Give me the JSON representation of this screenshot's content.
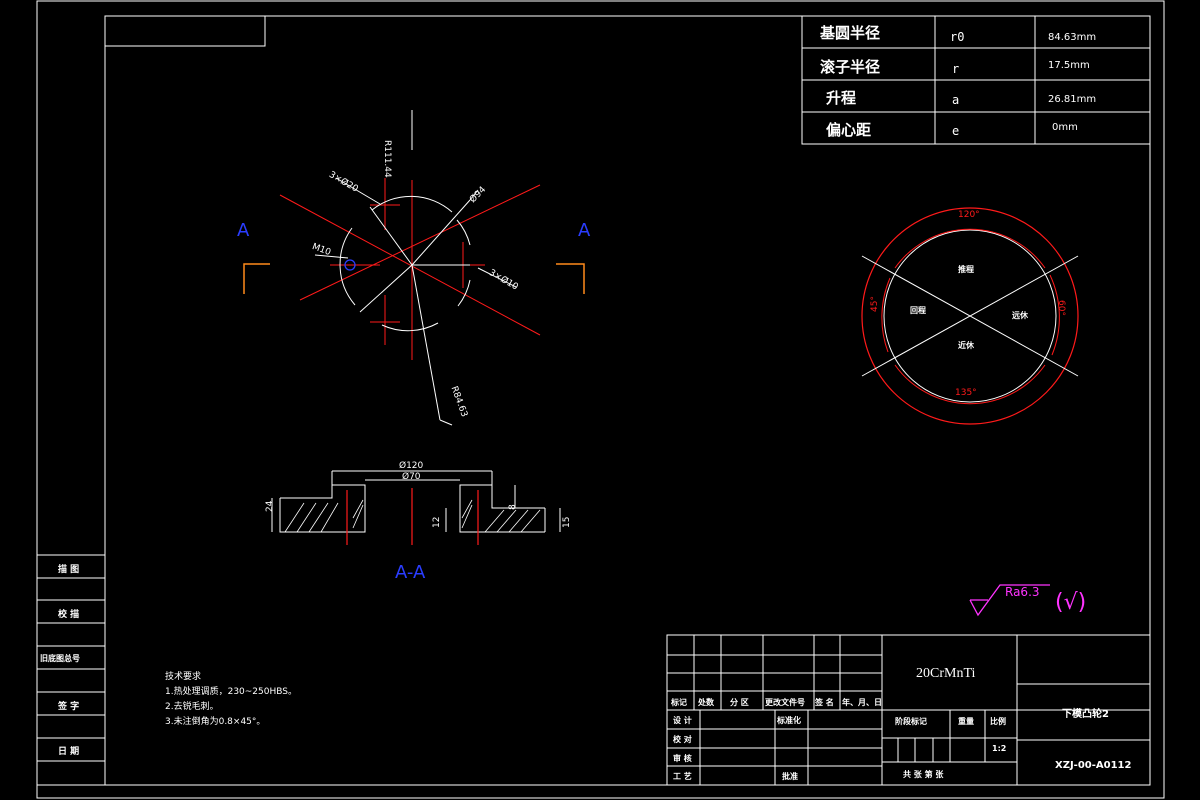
{
  "params": [
    {
      "label": "基圆半径",
      "symbol": "r0",
      "value": "84.63mm"
    },
    {
      "label": "滚子半径",
      "symbol": "r",
      "value": "17.5mm"
    },
    {
      "label": "升程",
      "symbol": "a",
      "value": "26.81mm"
    },
    {
      "label": "偏心距",
      "symbol": "e",
      "value": "0mm"
    }
  ],
  "section_marks": {
    "left": "A",
    "right": "A",
    "view": "A-A"
  },
  "plan_dims": {
    "r_top": "R111.44",
    "holes_20": "3×Ø20",
    "d_94": "Ø94",
    "m10": "M10",
    "holes_10": "3×Ø10",
    "r_bottom": "R84.63"
  },
  "section_dims": {
    "d120": "Ø120",
    "d70": "Ø70",
    "h24": "24",
    "h12": "12",
    "h8": "8",
    "h15": "15"
  },
  "cam_diagram": {
    "angle_top": "120°",
    "angle_left": "45°",
    "angle_right": "60°",
    "angle_bottom": "135°",
    "zone_top": "推程",
    "zone_left": "回程",
    "zone_right": "远休",
    "zone_bottom": "近休"
  },
  "roughness": {
    "value": "Ra6.3",
    "mark": "(√)"
  },
  "left_strip": [
    "描 图",
    "校 描",
    "旧底图总号",
    "签 字",
    "日 期"
  ],
  "notes": {
    "title": "技术要求",
    "lines": [
      "1.热处理调质，230~250HBS。",
      "2.去锐毛刺。",
      "3.未注倒角为0.8×45°。"
    ]
  },
  "title_block": {
    "material": "20CrMnTi",
    "part_name": "下模凸轮2",
    "drawing_no": "XZJ-00-A0112",
    "revision_header": [
      "标记",
      "处数",
      "分 区",
      "更改文件号",
      "签 名",
      "年、月、日"
    ],
    "rows": [
      "设 计",
      "校 对",
      "审 核",
      "工 艺"
    ],
    "standardization": "标准化",
    "approval": "批准",
    "stage_mark": "阶段标记",
    "weight": "重量",
    "scale_label": "比例",
    "scale": "1:2",
    "sheets": "共  张  第  张"
  },
  "colors": {
    "red": "#ff1a1a",
    "blue": "#2a3dff",
    "magenta": "#ff33ff",
    "orange": "#ff8a1a",
    "white": "#ffffff"
  }
}
